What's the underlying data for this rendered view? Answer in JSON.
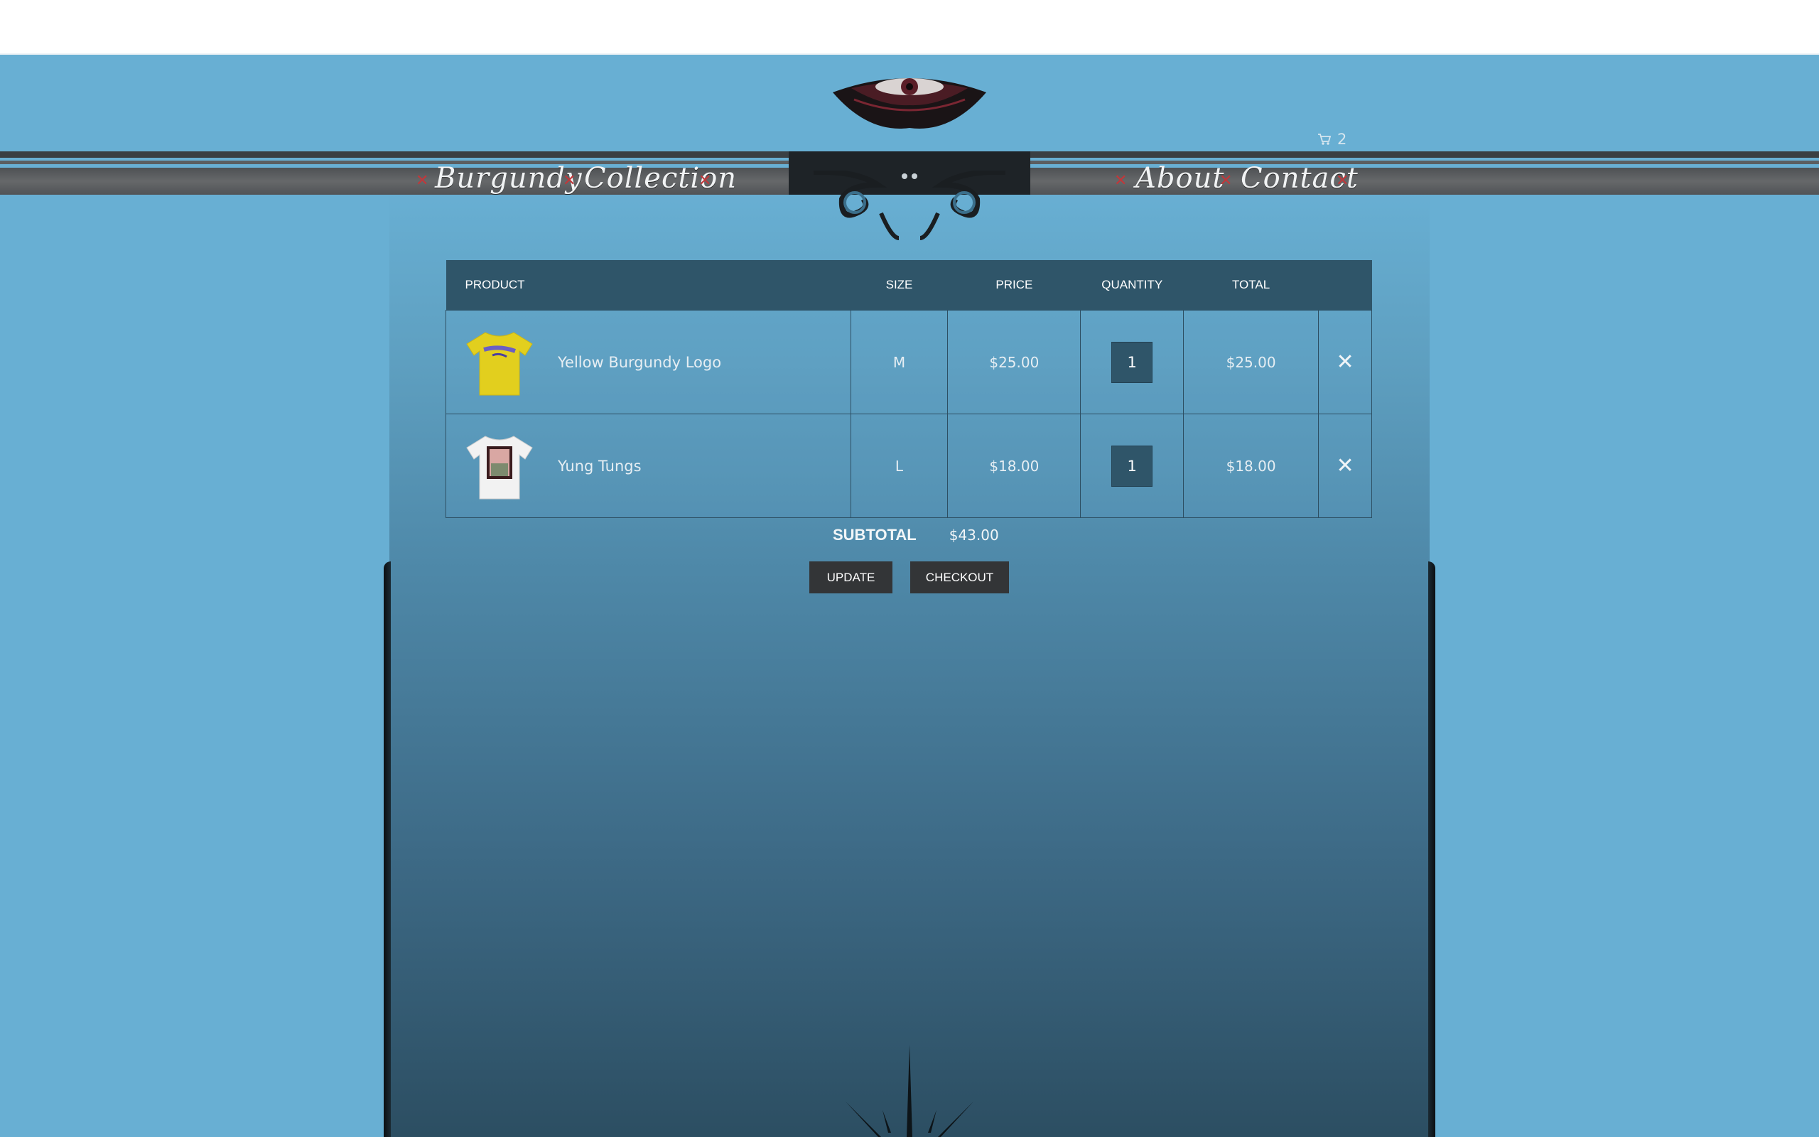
{
  "nav": {
    "left": [
      "Burgundy",
      "Collection"
    ],
    "right": [
      "About",
      "Contact"
    ]
  },
  "cart": {
    "count": "2"
  },
  "table": {
    "headers": {
      "product": "PRODUCT",
      "size": "SIZE",
      "price": "PRICE",
      "quantity": "QUANTITY",
      "total": "TOTAL"
    },
    "rows": [
      {
        "name": "Yellow Burgundy Logo",
        "size": "M",
        "price": "$25.00",
        "quantity": "1",
        "total": "$25.00",
        "remove": "✕",
        "shirt_color": "#e2cf1e"
      },
      {
        "name": "Yung Tungs",
        "size": "L",
        "price": "$18.00",
        "quantity": "1",
        "total": "$18.00",
        "remove": "✕",
        "shirt_color": "#f2f2f2"
      }
    ]
  },
  "summary": {
    "subtotal_label": "SUBTOTAL",
    "subtotal_value": "$43.00"
  },
  "buttons": {
    "update": "UPDATE",
    "checkout": "CHECKOUT"
  }
}
